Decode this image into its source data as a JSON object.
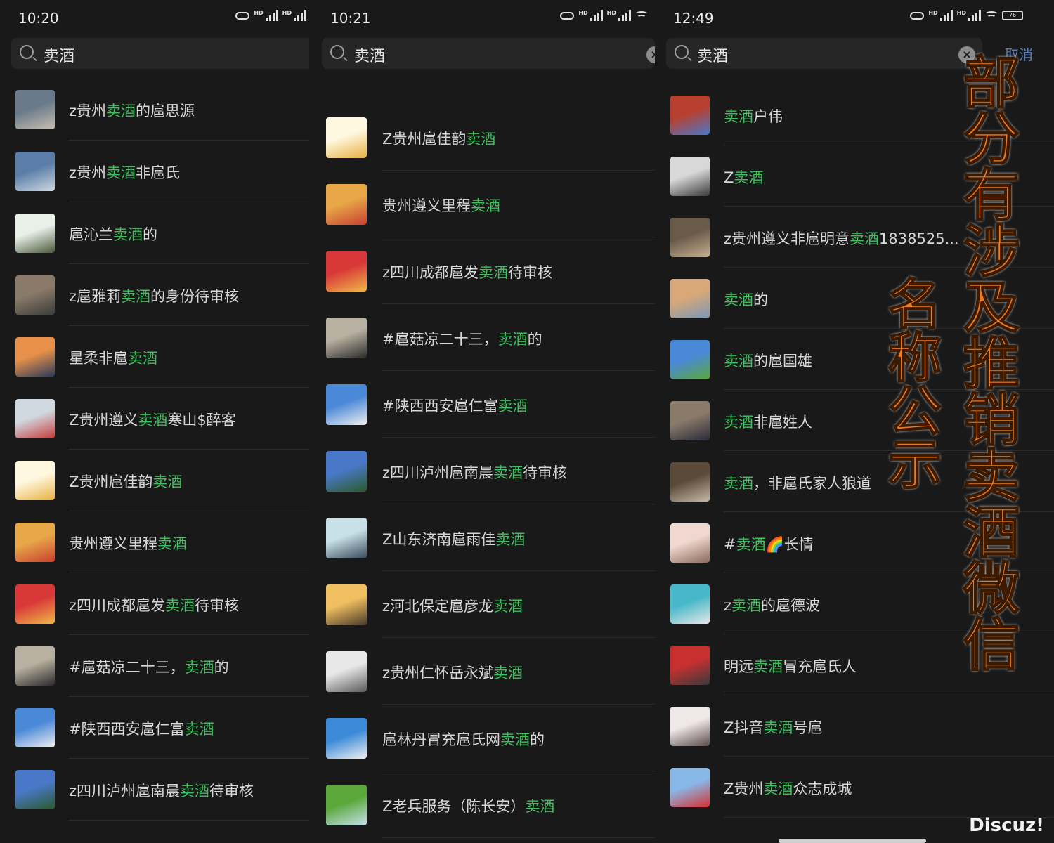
{
  "search_term": "卖酒",
  "panels": [
    {
      "time": "10:20",
      "items": [
        {
          "pre": "z贵州",
          "hl": "卖酒",
          "post": "的扈思源",
          "colors": [
            "#6a7a8a",
            "#c8c0b0"
          ]
        },
        {
          "pre": "z贵州",
          "hl": "卖酒",
          "post": "非扈氏",
          "colors": [
            "#5a7ea8",
            "#cfd8e0"
          ]
        },
        {
          "pre": "扈沁兰",
          "hl": "卖酒",
          "post": "的",
          "colors": [
            "#e8f0e8",
            "#4a5a3a"
          ]
        },
        {
          "pre": "z扈雅莉",
          "hl": "卖酒",
          "post": "的身份待审核",
          "colors": [
            "#8a7a6a",
            "#3a3a3a"
          ]
        },
        {
          "pre": "星柔非扈",
          "hl": "卖酒",
          "post": "",
          "colors": [
            "#e8904a",
            "#2a3a5a"
          ]
        },
        {
          "pre": "Z贵州遵义",
          "hl": "卖酒",
          "post": "寒山$醉客",
          "colors": [
            "#d0d8e0",
            "#c83a3a"
          ]
        },
        {
          "pre": "Z贵州扈佳韵",
          "hl": "卖酒",
          "post": "",
          "colors": [
            "#fff8e0",
            "#e8b040"
          ]
        },
        {
          "pre": "贵州遵义里程",
          "hl": "卖酒",
          "post": "",
          "colors": [
            "#e8a848",
            "#c84030"
          ]
        },
        {
          "pre": "z四川成都扈发",
          "hl": "卖酒",
          "post": "待审核",
          "colors": [
            "#d83838",
            "#f0b848"
          ]
        },
        {
          "pre": "#扈菇凉二十三，",
          "hl": "卖酒",
          "post": "的",
          "colors": [
            "#b8b0a0",
            "#2a2a2a"
          ]
        },
        {
          "pre": "#陕西西安扈仁富",
          "hl": "卖酒",
          "post": "",
          "colors": [
            "#4a88d8",
            "#f0f0f0"
          ]
        },
        {
          "pre": "z四川泸州扈南晨",
          "hl": "卖酒",
          "post": "待审核",
          "colors": [
            "#4a78c8",
            "#2a5a2a"
          ]
        }
      ]
    },
    {
      "time": "10:21",
      "items": [
        {
          "pre": "Z贵州扈佳韵",
          "hl": "卖酒",
          "post": "",
          "colors": [
            "#fff8e0",
            "#e8b040"
          ]
        },
        {
          "pre": "贵州遵义里程",
          "hl": "卖酒",
          "post": "",
          "colors": [
            "#e8a848",
            "#c84030"
          ]
        },
        {
          "pre": "z四川成都扈发",
          "hl": "卖酒",
          "post": "待审核",
          "colors": [
            "#d83838",
            "#f0b848"
          ]
        },
        {
          "pre": "#扈菇凉二十三，",
          "hl": "卖酒",
          "post": "的",
          "colors": [
            "#b8b0a0",
            "#2a2a2a"
          ]
        },
        {
          "pre": "#陕西西安扈仁富",
          "hl": "卖酒",
          "post": "",
          "colors": [
            "#4a88d8",
            "#f0f0f0"
          ]
        },
        {
          "pre": "z四川泸州扈南晨",
          "hl": "卖酒",
          "post": "待审核",
          "colors": [
            "#4a78c8",
            "#2a5a2a"
          ]
        },
        {
          "pre": "Z山东济南扈雨佳",
          "hl": "卖酒",
          "post": "",
          "colors": [
            "#c8e0e8",
            "#3a4a5a"
          ]
        },
        {
          "pre": "z河北保定扈彦龙",
          "hl": "卖酒",
          "post": "",
          "colors": [
            "#f0c060",
            "#4a3a2a"
          ]
        },
        {
          "pre": "z贵州仁怀岳永斌",
          "hl": "卖酒",
          "post": "",
          "colors": [
            "#e8e8e8",
            "#5a5a5a"
          ]
        },
        {
          "pre": "扈林丹冒充扈氏网",
          "hl": "卖酒",
          "post": "的",
          "colors": [
            "#3a8ad8",
            "#f0f0f0"
          ]
        },
        {
          "pre": "Z老兵服务（陈长安）",
          "hl": "卖酒",
          "post": "",
          "colors": [
            "#5aa83a",
            "#c8e0f0"
          ]
        }
      ]
    },
    {
      "time": "12:49",
      "battery": "76",
      "cancel_label": "取消",
      "items": [
        {
          "pre": "",
          "hl": "卖酒",
          "post": "户伟",
          "colors": [
            "#b84030",
            "#4a78c8"
          ]
        },
        {
          "pre": "Z",
          "hl": "卖酒",
          "post": "",
          "colors": [
            "#d8d8d8",
            "#3a3a3a"
          ]
        },
        {
          "pre": "z贵州遵义非扈明意",
          "hl": "卖酒",
          "post": "1838525...",
          "colors": [
            "#6a5a4a",
            "#c8b090"
          ]
        },
        {
          "pre": "",
          "hl": "卖酒",
          "post": "的",
          "colors": [
            "#d8a878",
            "#7a98b8"
          ]
        },
        {
          "pre": "",
          "hl": "卖酒",
          "post": "的扈国雄",
          "colors": [
            "#4a88d8",
            "#5aa83a"
          ]
        },
        {
          "pre": "",
          "hl": "卖酒",
          "post": "非扈姓人",
          "colors": [
            "#8a7a6a",
            "#2a2a3a"
          ]
        },
        {
          "pre": "",
          "hl": "卖酒",
          "post": "，非扈氏家人狼道",
          "colors": [
            "#5a4a3a",
            "#c8b8a8"
          ]
        },
        {
          "pre": "#",
          "hl": "卖酒",
          "post": "🌈长情",
          "colors": [
            "#f0d8d0",
            "#8a6a5a"
          ]
        },
        {
          "pre": "z",
          "hl": "卖酒",
          "post": "的扈德波",
          "colors": [
            "#48b8c8",
            "#e8e8e8"
          ]
        },
        {
          "pre": "明远",
          "hl": "卖酒",
          "post": "冒充扈氏人",
          "colors": [
            "#c83030",
            "#3a3a3a"
          ]
        },
        {
          "pre": "Z抖音",
          "hl": "卖酒",
          "post": "号扈",
          "colors": [
            "#f0e8e8",
            "#5a4a4a"
          ]
        },
        {
          "pre": "Z贵州",
          "hl": "卖酒",
          "post": "众志成城",
          "colors": [
            "#88b8e8",
            "#d83030"
          ]
        }
      ]
    }
  ],
  "overlay": {
    "right_text": "部分有涉及推销卖酒微信",
    "left_text": "名称公示"
  },
  "watermark": "Discuz!"
}
